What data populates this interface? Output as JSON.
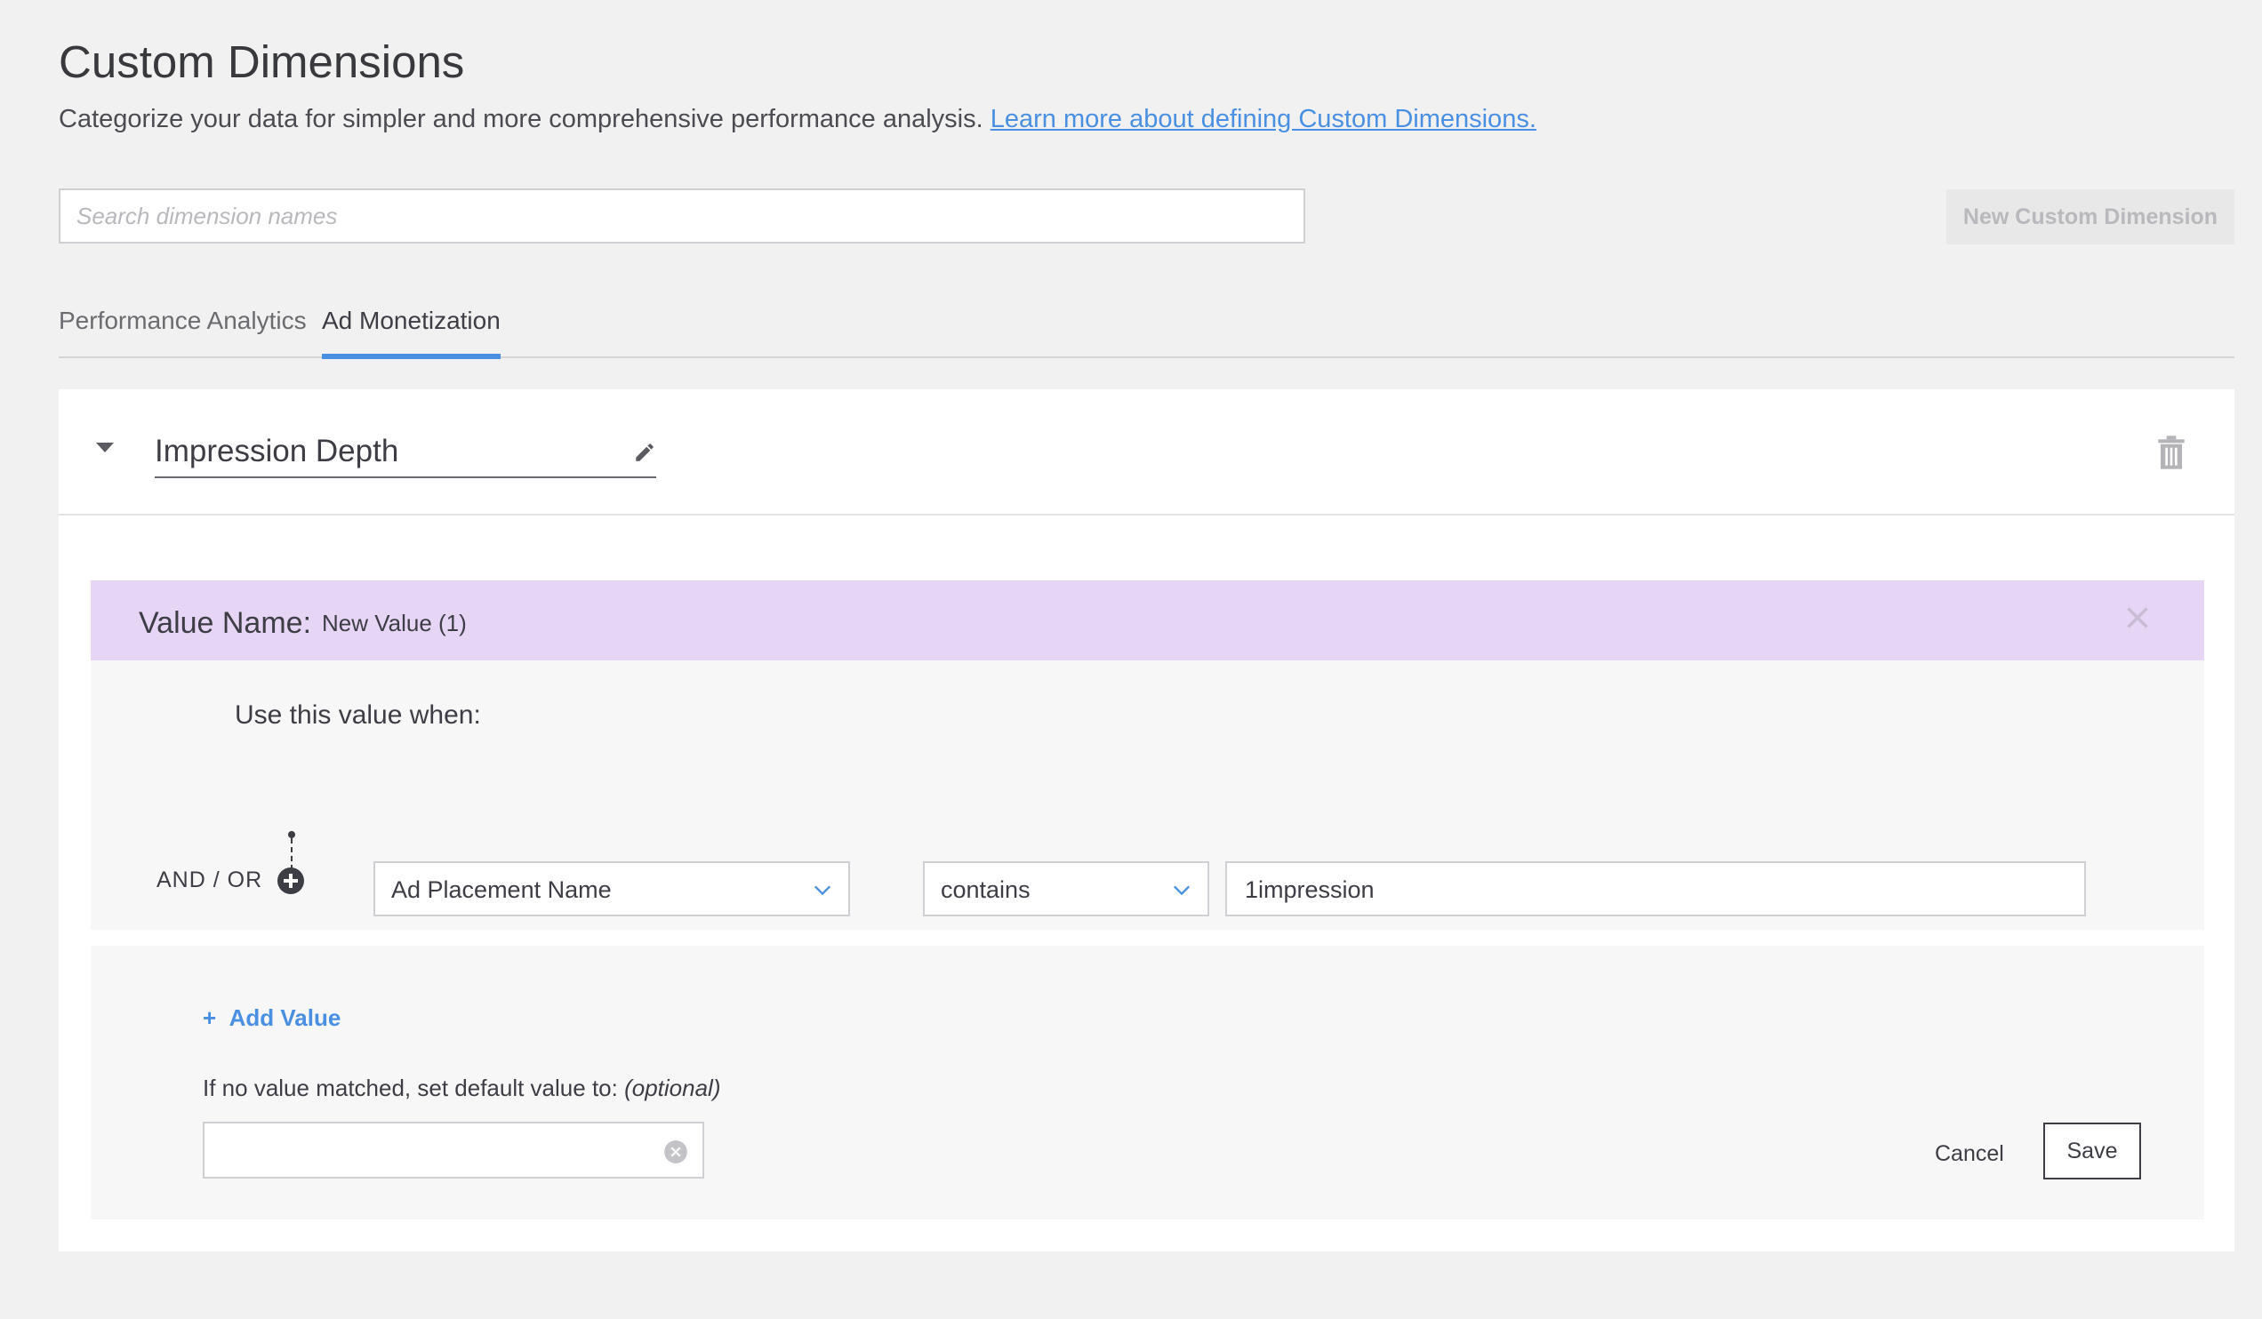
{
  "page": {
    "title": "Custom Dimensions",
    "subtitle": "Categorize your data for simpler and more comprehensive performance analysis.",
    "learn_more_link": "Learn more about defining Custom Dimensions."
  },
  "search": {
    "placeholder": "Search dimension names"
  },
  "new_button": {
    "label": "New Custom Dimension"
  },
  "tabs": [
    {
      "label": "Performance Analytics",
      "active": false
    },
    {
      "label": "Ad Monetization",
      "active": true
    }
  ],
  "dimension": {
    "name": "Impression Depth",
    "icons": {
      "collapse": "caret-down-icon",
      "edit": "pencil-icon",
      "delete": "trash-icon"
    }
  },
  "value": {
    "label": "Value Name:",
    "name": "New Value (1)",
    "use_when": "Use this value when:",
    "and_or": "AND / OR",
    "condition": {
      "field": "Ad Placement Name",
      "operator": "contains",
      "value": "1impression"
    }
  },
  "footer": {
    "add_value": "Add Value",
    "add_value_prefix": "+",
    "default_label": "If no value matched, set default value to:",
    "default_optional": "(optional)",
    "default_value": "",
    "cancel": "Cancel",
    "save": "Save"
  },
  "colors": {
    "accent": "#4a90e2",
    "value_header_bg": "#e6d5f5",
    "page_bg": "#f1f1f1"
  }
}
